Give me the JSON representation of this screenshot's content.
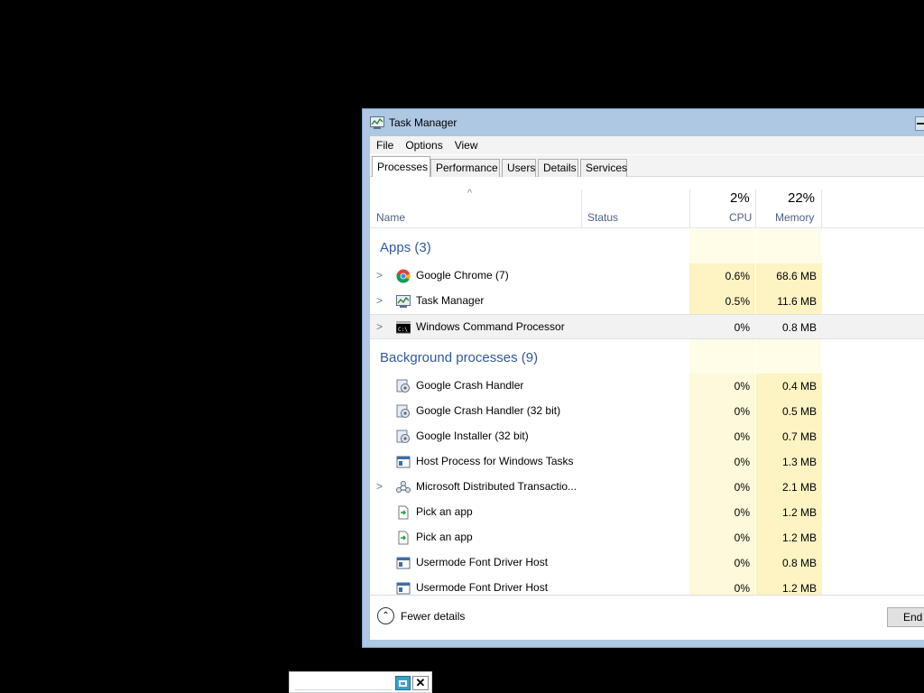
{
  "window": {
    "title": "Task Manager"
  },
  "menu": {
    "file": "File",
    "options": "Options",
    "view": "View"
  },
  "tabs": [
    "Processes",
    "Performance",
    "Users",
    "Details",
    "Services"
  ],
  "columns": {
    "name": "Name",
    "status": "Status",
    "cpu_pct": "2%",
    "cpu": "CPU",
    "memory_pct": "22%",
    "memory": "Memory"
  },
  "groups": {
    "apps": "Apps (3)",
    "background": "Background processes (9)"
  },
  "apps": [
    {
      "name": "Google Chrome (7)",
      "cpu": "0.6%",
      "memory": "68.6 MB",
      "icon": "chrome-icon"
    },
    {
      "name": "Task Manager",
      "cpu": "0.5%",
      "memory": "11.6 MB",
      "icon": "task-manager-icon"
    },
    {
      "name": "Windows Command Processor",
      "cpu": "0%",
      "memory": "0.8 MB",
      "icon": "cmd-icon"
    }
  ],
  "background": [
    {
      "name": "Google Crash Handler",
      "cpu": "0%",
      "memory": "0.4 MB",
      "icon": "service-icon"
    },
    {
      "name": "Google Crash Handler (32 bit)",
      "cpu": "0%",
      "memory": "0.5 MB",
      "icon": "service-icon"
    },
    {
      "name": "Google Installer (32 bit)",
      "cpu": "0%",
      "memory": "0.7 MB",
      "icon": "service-icon"
    },
    {
      "name": "Host Process for Windows Tasks",
      "cpu": "0%",
      "memory": "1.3 MB",
      "icon": "window-app-icon"
    },
    {
      "name": "Microsoft Distributed Transactio...",
      "cpu": "0%",
      "memory": "2.1 MB",
      "icon": "network-icon"
    },
    {
      "name": "Pick an app",
      "cpu": "0%",
      "memory": "1.2 MB",
      "icon": "pick-app-icon"
    },
    {
      "name": "Pick an app",
      "cpu": "0%",
      "memory": "1.2 MB",
      "icon": "pick-app-icon"
    },
    {
      "name": "Usermode Font Driver Host",
      "cpu": "0%",
      "memory": "0.8 MB",
      "icon": "window-app-icon"
    },
    {
      "name": "Usermode Font Driver Host",
      "cpu": "0%",
      "memory": "1.2 MB",
      "icon": "window-app-icon"
    }
  ],
  "footer": {
    "fewer_details": "Fewer details",
    "end_task": "End t"
  },
  "colors": {
    "accent": "#2f5a9b",
    "titlebar": "#aec7e2",
    "cpu_highlight": "#fdf3c3"
  }
}
